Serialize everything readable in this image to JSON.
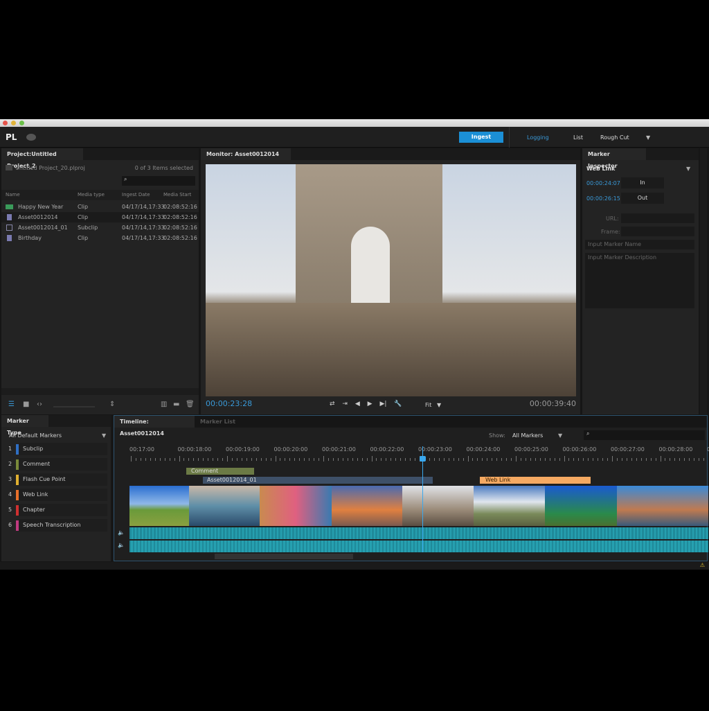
{
  "app": {
    "logo": "PL",
    "cloud_icon": "creative-cloud-icon"
  },
  "workspaces": {
    "ingest": "Ingest",
    "logging": "Logging",
    "list": "List",
    "rough_cut": "Rough Cut"
  },
  "colors": {
    "accent": "#1b8fd6",
    "timecode": "#3a9ad9",
    "subclip": "#2f6fc4",
    "comment": "#7a8a3a",
    "flash": "#e0b030",
    "weblink": "#f0a050",
    "chapter": "#d03030",
    "speech": "#c03a80"
  },
  "project": {
    "tab": "Project:Untitled Project_2",
    "file": "Untitled Project_20.plproj",
    "selected": "0 of 3 Items selected",
    "search_placeholder": "",
    "columns": [
      "Name",
      "Media type",
      "Ingest Date",
      "Media Start"
    ],
    "rows": [
      {
        "name": "Happy New Year",
        "type": "Clip",
        "date": "04/17/14,17:33",
        "start": "02:08:52:16",
        "icon": "audio-clip-icon"
      },
      {
        "name": "Asset0012014",
        "type": "Clip",
        "date": "04/17/14,17:33",
        "start": "02:08:52:16",
        "icon": "video-clip-icon"
      },
      {
        "name": "Asset0012014_01",
        "type": "Subclip",
        "date": "04/17/14,17:33",
        "start": "02:08:52:16",
        "icon": "subclip-icon"
      },
      {
        "name": "Birthday",
        "type": "Clip",
        "date": "04/17/14,17:33",
        "start": "02:08:52:16",
        "icon": "video-clip-icon"
      }
    ]
  },
  "monitor": {
    "tab": "Monitor: Asset0012014",
    "current": "00:00:23:28",
    "duration": "00:00:39:40",
    "zoom": "Fit"
  },
  "inspector": {
    "tab": "Marker Inspector",
    "type": "Web Link",
    "in_time": "00:00:24:07",
    "in_label": "In",
    "out_time": "00:00:26:15",
    "out_label": "Out",
    "url_label": "URL:",
    "frame_label": "Frame:",
    "name_placeholder": "Input Marker Name",
    "desc_placeholder": "Input Marker Description"
  },
  "marker_type": {
    "tab": "Marker Type",
    "filter": "All Default Markers",
    "items": [
      {
        "n": "1",
        "label": "Subclip"
      },
      {
        "n": "2",
        "label": "Comment"
      },
      {
        "n": "3",
        "label": "Flash Cue Point"
      },
      {
        "n": "4",
        "label": "Web Link"
      },
      {
        "n": "5",
        "label": "Chapter"
      },
      {
        "n": "6",
        "label": "Speech Transcription"
      }
    ]
  },
  "timeline": {
    "tab": "Timeline: Asset0012014",
    "tab2": "Marker List",
    "show_label": "Show:",
    "show_value": "All Markers",
    "ticks": [
      "00:17:00",
      "00:00:18:00",
      "00:00:19:00",
      "00:00:20:00",
      "00:00:21:00",
      "00:00:22:00",
      "00:00:23:00",
      "00:00:24:00",
      "00:00:25:00",
      "00:00:26:00",
      "00:00:27:00",
      "00:00:28:00",
      "00:"
    ],
    "markers": {
      "comment": "Comment",
      "subclip": "Asset0012014_01",
      "weblink": "Web Link"
    }
  }
}
